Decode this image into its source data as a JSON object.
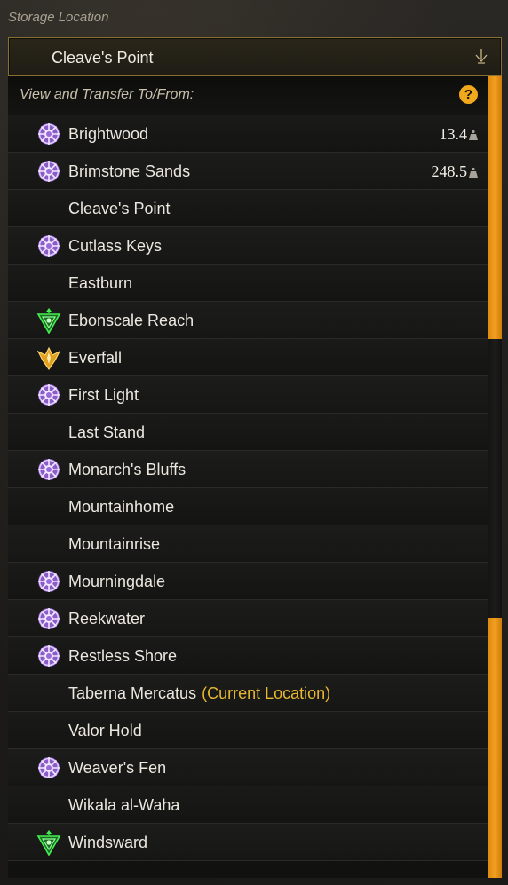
{
  "storage_label": "Storage Location",
  "dropdown": {
    "value": "Cleave's Point",
    "icon": "chevron-down-icon"
  },
  "list_header": {
    "text": "View and Transfer To/From:",
    "help_glyph": "?"
  },
  "colors": {
    "accent_gold": "#f0a81c",
    "current_location": "#e8b830",
    "faction_purple": "#b080e0",
    "faction_green": "#3ee04a",
    "faction_gold": "#e8a820"
  },
  "locations": [
    {
      "name": "Brightwood",
      "icon": "covenant-purple-icon",
      "weight": "13.4"
    },
    {
      "name": "Brimstone Sands",
      "icon": "covenant-purple-icon",
      "weight": "248.5"
    },
    {
      "name": "Cleave's Point",
      "icon": ""
    },
    {
      "name": "Cutlass Keys",
      "icon": "covenant-purple-icon"
    },
    {
      "name": "Eastburn",
      "icon": ""
    },
    {
      "name": "Ebonscale Reach",
      "icon": "syndicate-green-icon"
    },
    {
      "name": "Everfall",
      "icon": "marauder-gold-icon"
    },
    {
      "name": "First Light",
      "icon": "covenant-purple-icon"
    },
    {
      "name": "Last Stand",
      "icon": ""
    },
    {
      "name": "Monarch's Bluffs",
      "icon": "covenant-purple-icon"
    },
    {
      "name": "Mountainhome",
      "icon": ""
    },
    {
      "name": "Mountainrise",
      "icon": ""
    },
    {
      "name": "Mourningdale",
      "icon": "covenant-purple-icon"
    },
    {
      "name": "Reekwater",
      "icon": "covenant-purple-icon"
    },
    {
      "name": "Restless Shore",
      "icon": "covenant-purple-icon"
    },
    {
      "name": "Taberna Mercatus",
      "icon": "",
      "suffix": "(Current Location)"
    },
    {
      "name": "Valor Hold",
      "icon": ""
    },
    {
      "name": "Weaver's Fen",
      "icon": "covenant-purple-icon"
    },
    {
      "name": "Wikala al-Waha",
      "icon": ""
    },
    {
      "name": "Windsward",
      "icon": "syndicate-green-icon"
    }
  ]
}
